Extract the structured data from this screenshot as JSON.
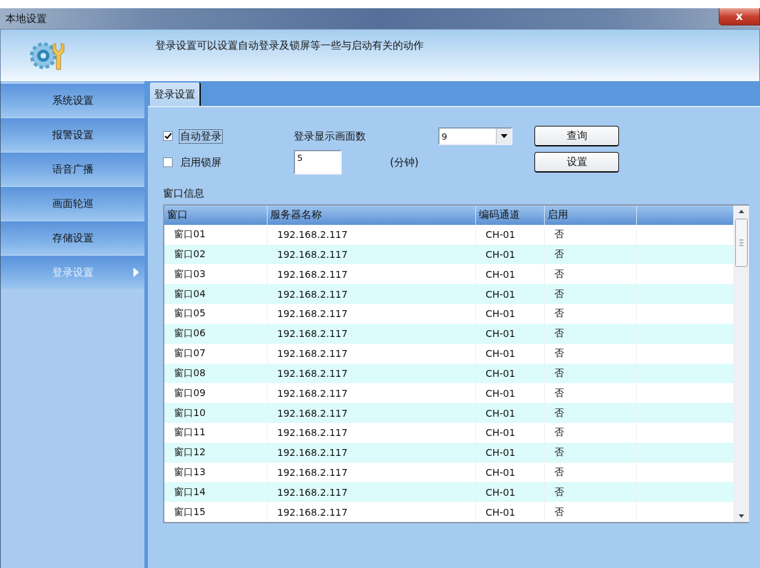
{
  "window": {
    "title": "本地设置",
    "close": "x"
  },
  "header": {
    "description": "登录设置可以设置自动登录及锁屏等一些与启动有关的动作"
  },
  "sidebar": {
    "items": [
      {
        "label": "系统设置",
        "selected": false
      },
      {
        "label": "报警设置",
        "selected": false
      },
      {
        "label": "语音广播",
        "selected": false
      },
      {
        "label": "画面轮巡",
        "selected": false
      },
      {
        "label": "存储设置",
        "selected": false
      },
      {
        "label": "登录设置",
        "selected": true
      }
    ]
  },
  "tabs": [
    {
      "label": "登录设置",
      "selected": true
    }
  ],
  "form": {
    "auto_login": {
      "label": "自动登录",
      "checked": true,
      "focused": true
    },
    "display_count": {
      "label": "登录显示画面数",
      "value": "9"
    },
    "lock_screen": {
      "label": "启用锁屏",
      "checked": false
    },
    "lock_minutes": {
      "value": "5",
      "unit": "(分钟)"
    },
    "buttons": [
      "查询",
      "设置"
    ]
  },
  "table": {
    "title": "窗口信息",
    "columns": [
      "窗口",
      "服务器名称",
      "编码通道",
      "启用"
    ],
    "rows": [
      [
        "窗口01",
        "192.168.2.117",
        "CH-01",
        "否"
      ],
      [
        "窗口02",
        "192.168.2.117",
        "CH-01",
        "否"
      ],
      [
        "窗口03",
        "192.168.2.117",
        "CH-01",
        "否"
      ],
      [
        "窗口04",
        "192.168.2.117",
        "CH-01",
        "否"
      ],
      [
        "窗口05",
        "192.168.2.117",
        "CH-01",
        "否"
      ],
      [
        "窗口06",
        "192.168.2.117",
        "CH-01",
        "否"
      ],
      [
        "窗口07",
        "192.168.2.117",
        "CH-01",
        "否"
      ],
      [
        "窗口08",
        "192.168.2.117",
        "CH-01",
        "否"
      ],
      [
        "窗口09",
        "192.168.2.117",
        "CH-01",
        "否"
      ],
      [
        "窗口10",
        "192.168.2.117",
        "CH-01",
        "否"
      ],
      [
        "窗口11",
        "192.168.2.117",
        "CH-01",
        "否"
      ],
      [
        "窗口12",
        "192.168.2.117",
        "CH-01",
        "否"
      ],
      [
        "窗口13",
        "192.168.2.117",
        "CH-01",
        "否"
      ],
      [
        "窗口14",
        "192.168.2.117",
        "CH-01",
        "否"
      ],
      [
        "窗口15",
        "192.168.2.117",
        "CH-01",
        "否"
      ]
    ]
  }
}
